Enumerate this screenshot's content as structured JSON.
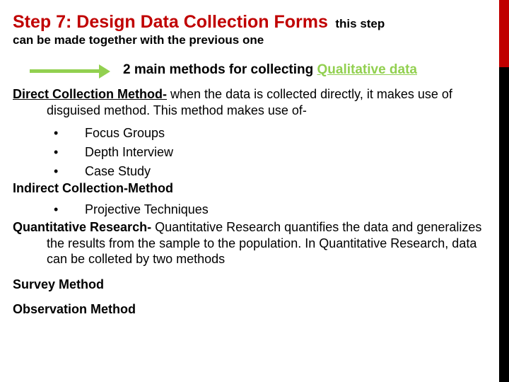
{
  "title": {
    "main": "Step 7: Design Data Collection Forms",
    "sub1": "this step",
    "sub2": "can be made together with the previous one"
  },
  "methodsLine": {
    "prefix": "2 main methods for collecting ",
    "qual": "Qualitative data"
  },
  "direct": {
    "head": "Direct Collection Method-",
    "body": " when the data is collected directly, it makes use of disguised method. This method makes use of-",
    "bullets": [
      "Focus Groups",
      "Depth Interview",
      "Case Study"
    ]
  },
  "indirect": {
    "head": "Indirect Collection-Method",
    "bullets": [
      "Projective Techniques"
    ]
  },
  "quant": {
    "head": "Quantitative Research-",
    "body": " Quantitative Research quantifies the data and generalizes the results from the sample to the population. In Quantitative Research, data can be colleted by two methods"
  },
  "methods": {
    "survey": "Survey Method",
    "observation": "Observation Method"
  }
}
